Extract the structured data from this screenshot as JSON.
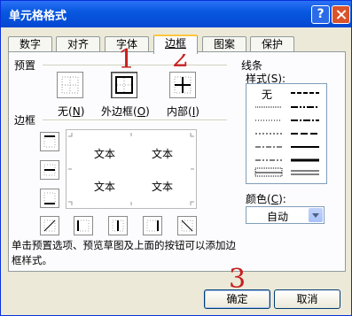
{
  "window": {
    "title": "单元格格式",
    "help_glyph": "?"
  },
  "tabs": [
    {
      "label": "数字"
    },
    {
      "label": "对齐"
    },
    {
      "label": "字体"
    },
    {
      "label": "边框",
      "active": true
    },
    {
      "label": "图案"
    },
    {
      "label": "保护"
    }
  ],
  "preset": {
    "section_label": "预置",
    "buttons": [
      {
        "label": "无",
        "accel": "N"
      },
      {
        "label": "外边框",
        "accel": "O"
      },
      {
        "label": "内部",
        "accel": "I"
      }
    ]
  },
  "border": {
    "section_label": "边框"
  },
  "preview": {
    "cells": [
      "文本",
      "文本",
      "文本",
      "文本"
    ]
  },
  "line": {
    "section_label": "线条",
    "style_label": "样式",
    "style_accel": "S",
    "none_label": "无",
    "color_label": "颜色",
    "color_accel": "C",
    "color_value": "自动"
  },
  "hint": "单击预置选项、预览草图及上面的按钮可以添加边框样式。",
  "buttons": {
    "ok": "确定",
    "cancel": "取消"
  },
  "annotations": [
    "1",
    "2",
    "3"
  ],
  "colors": {
    "title_bar": "#0858e0",
    "dialog_bg": "#ece9d8",
    "annotation": "#c62020"
  }
}
